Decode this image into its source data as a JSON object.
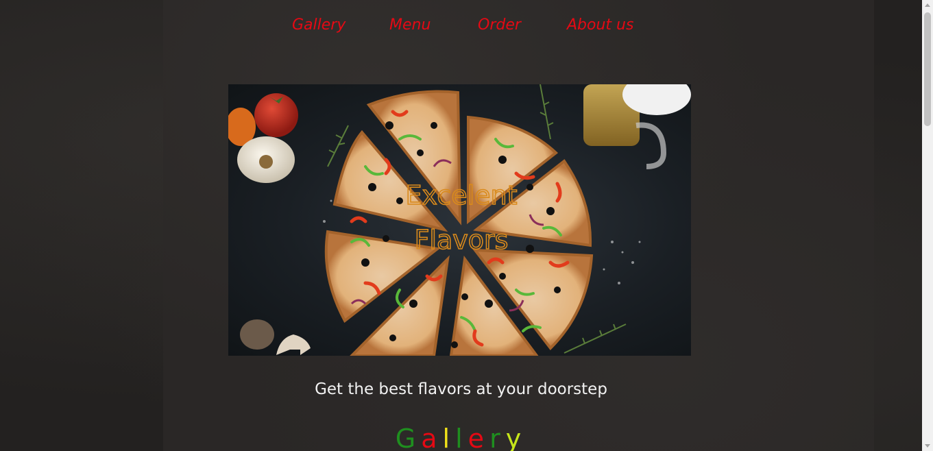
{
  "nav": {
    "items": [
      {
        "label": "Gallery"
      },
      {
        "label": "Menu"
      },
      {
        "label": "Order"
      },
      {
        "label": "About us"
      }
    ],
    "color": "#e50914"
  },
  "hero": {
    "image": "pizza-photo",
    "overlay_line1": "Excelent",
    "overlay_line2": "Flavors"
  },
  "tagline": "Get the best flavors at your doorstep",
  "gallery_heading": {
    "letters": [
      {
        "char": "G",
        "color": "#1f8f1f"
      },
      {
        "char": "a",
        "color": "#e50914"
      },
      {
        "char": "l",
        "color": "#f2e21a"
      },
      {
        "char": "l",
        "color": "#1f8f1f"
      },
      {
        "char": "e",
        "color": "#e50914"
      },
      {
        "char": "r",
        "color": "#1f8f1f"
      },
      {
        "char": "y",
        "color": "#c6e61a"
      }
    ]
  }
}
